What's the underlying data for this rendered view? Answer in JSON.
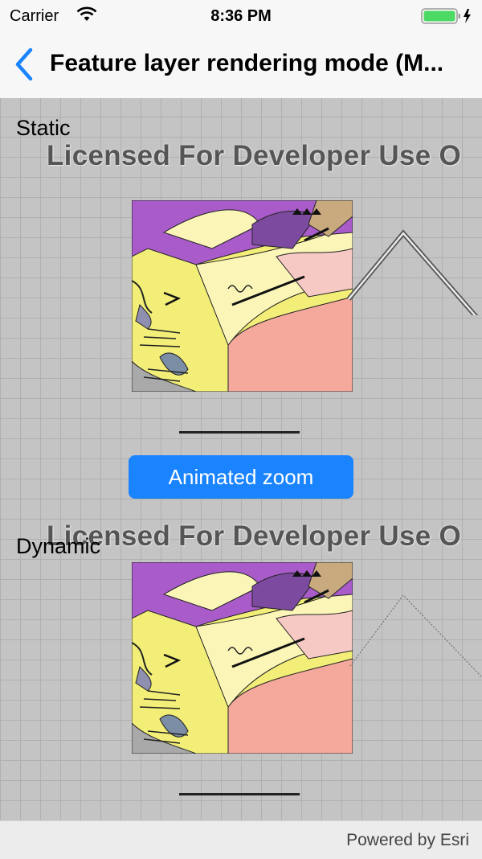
{
  "status_bar": {
    "carrier": "Carrier",
    "time": "8:36 PM"
  },
  "nav": {
    "title": "Feature layer rendering mode (M..."
  },
  "map": {
    "static_label": "Static",
    "dynamic_label": "Dynamic",
    "watermark_text": "Licensed For Developer Use O",
    "zoom_button_label": "Animated zoom"
  },
  "footer": {
    "attribution": "Powered by Esri"
  },
  "colors": {
    "accent": "#1a84ff",
    "map_background": "#c4c4c4"
  }
}
